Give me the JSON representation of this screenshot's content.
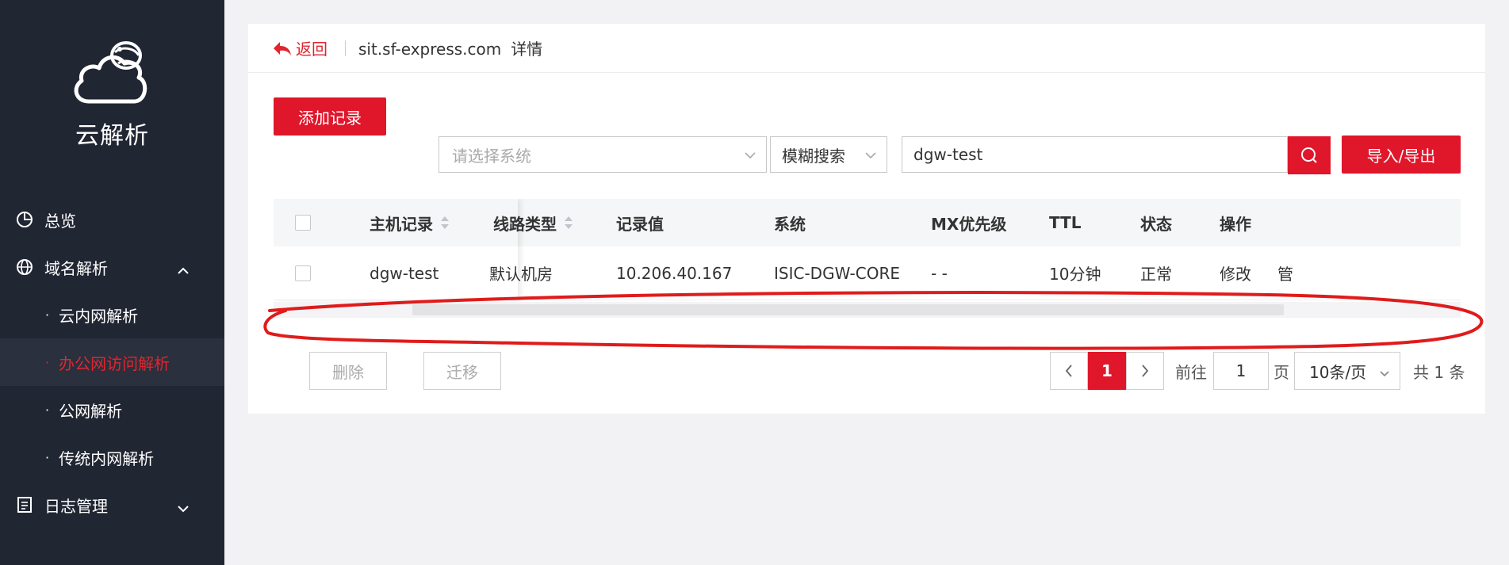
{
  "sidebar": {
    "logo_text": "云解析",
    "menu": [
      {
        "label": "总览"
      },
      {
        "label": "域名解析"
      },
      {
        "label": "日志管理"
      }
    ],
    "sub_items": [
      {
        "label": "云内网解析"
      },
      {
        "label": "办公网访问解析"
      },
      {
        "label": "公网解析"
      },
      {
        "label": "传统内网解析"
      }
    ]
  },
  "header": {
    "back_label": "返回",
    "domain": "sit.sf-express.com",
    "detail_label": "详情"
  },
  "toolbar": {
    "add_label": "添加记录",
    "system_placeholder": "请选择系统",
    "mode_value": "模糊搜索",
    "search_value": "dgw-test",
    "io_label": "导入/导出"
  },
  "table": {
    "columns": [
      "主机记录",
      "线路类型",
      "记录值",
      "系统",
      "MX优先级",
      "TTL",
      "状态",
      "操作"
    ],
    "rows": [
      {
        "host": "dgw-test",
        "line": "默认机房",
        "value": "10.206.40.167",
        "system": "ISIC-DGW-CORE",
        "mx": "- -",
        "ttl": "10分钟",
        "status": "正常",
        "edit": "修改",
        "more": "管"
      }
    ]
  },
  "bottom": {
    "delete_label": "删除",
    "migrate_label": "迁移",
    "current_page": "1",
    "goto_label": "前往",
    "goto_value": "1",
    "page_unit": "页",
    "page_size": "10条/页",
    "total_label": "共 1 条"
  },
  "colors": {
    "brand_red": "#e0162b",
    "sidebar_bg": "#212633",
    "status_green": "#18b04a",
    "link_blue": "#2d8cf0"
  }
}
